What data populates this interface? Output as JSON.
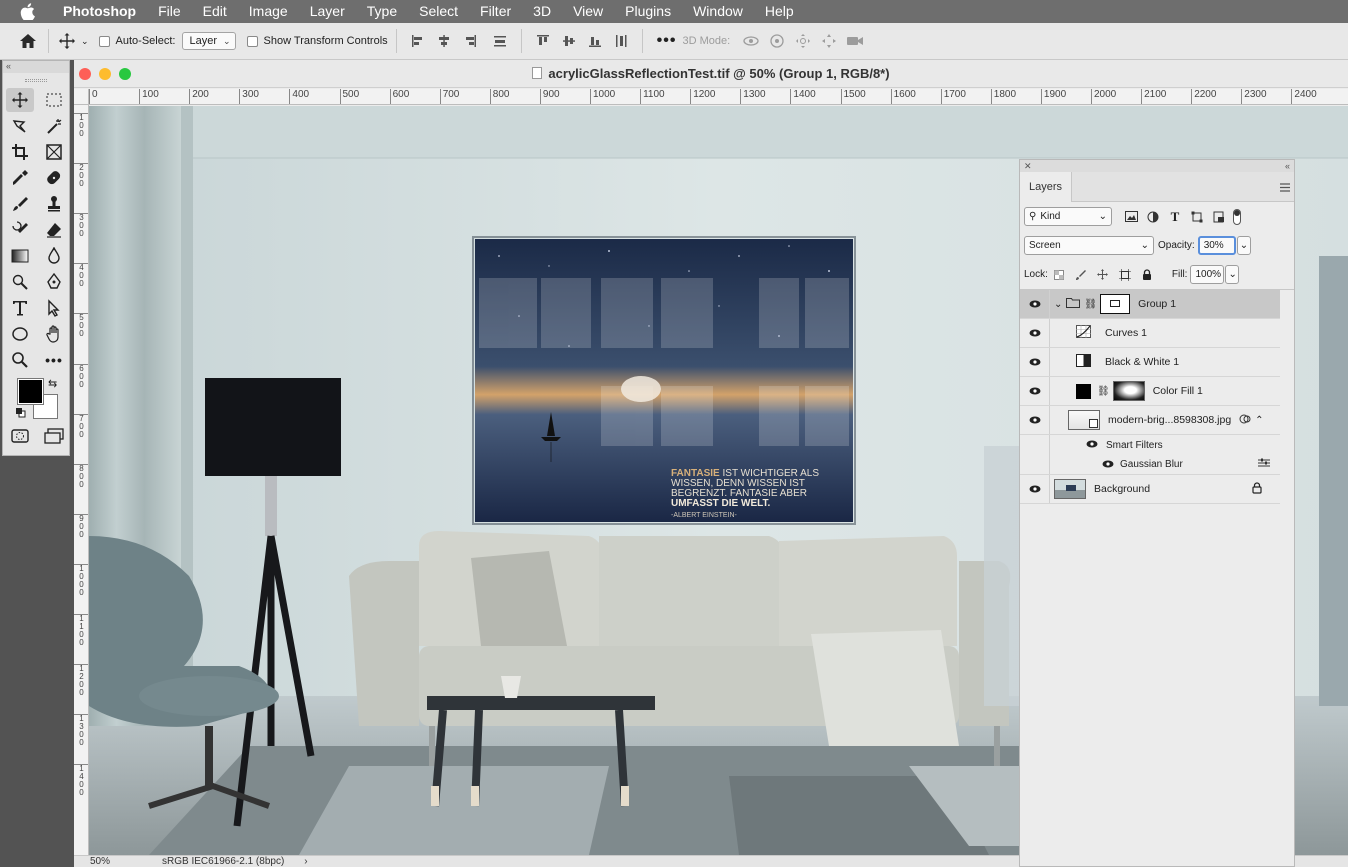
{
  "menubar": {
    "app": "Photoshop",
    "items": [
      "File",
      "Edit",
      "Image",
      "Layer",
      "Type",
      "Select",
      "Filter",
      "3D",
      "View",
      "Plugins",
      "Window",
      "Help"
    ]
  },
  "options": {
    "auto_select_label": "Auto-Select:",
    "auto_select_value": "Layer",
    "transform_label": "Show Transform Controls",
    "mode3d_label": "3D Mode:"
  },
  "document": {
    "title": "acrylicGlassReflectionTest.tif @ 50% (Group 1, RGB/8*)",
    "zoom": "50%",
    "profile": "sRGB IEC61966-2.1 (8bpc)",
    "ruler_h": [
      "0",
      "100",
      "200",
      "300",
      "400",
      "500",
      "600",
      "700",
      "800",
      "900",
      "1000",
      "1100",
      "1200",
      "1300",
      "1400",
      "1500",
      "1600",
      "1700",
      "1800",
      "1900",
      "2000",
      "2100",
      "2200",
      "2300",
      "2400"
    ],
    "ruler_v": [
      "1 0 0",
      "2 0 0",
      "3 0 0",
      "4 0 0",
      "5 0 0",
      "6 0 0",
      "7 0 0",
      "8 0 0",
      "9 0 0",
      "1 0 0 0",
      "1 1 0 0",
      "1 2 0 0",
      "1 3 0 0",
      "1 4 0 0"
    ]
  },
  "artwork": {
    "quote_bold1": "FANTASIE",
    "quote_line1": " IST WICHTIGER ALS",
    "quote_line2": "WISSEN, DENN WISSEN IST",
    "quote_line3": "BEGRENZT. FANTASIE ABER",
    "quote_bold2": "UMFASST DIE WELT.",
    "quote_author": "-ALBERT EINSTEIN-"
  },
  "layers_panel": {
    "tab": "Layers",
    "filter_kind": "Kind",
    "blend_mode": "Screen",
    "opacity_label": "Opacity:",
    "opacity_value": "30%",
    "lock_label": "Lock:",
    "fill_label": "Fill:",
    "fill_value": "100%",
    "layers": [
      {
        "name": "Group 1",
        "selected": true
      },
      {
        "name": "Curves 1"
      },
      {
        "name": "Black & White 1"
      },
      {
        "name": "Color Fill 1"
      },
      {
        "name": "modern-brig...8598308.jpg"
      },
      {
        "name": "Smart Filters"
      },
      {
        "name": "Gaussian Blur"
      },
      {
        "name": "Background"
      }
    ]
  },
  "colors": {
    "menubar": "#6e6e6e",
    "selected_layer": "#c8c8c8",
    "opacity_focus": "#5a8fdc",
    "foreground": "#000000",
    "background": "#ffffff"
  }
}
